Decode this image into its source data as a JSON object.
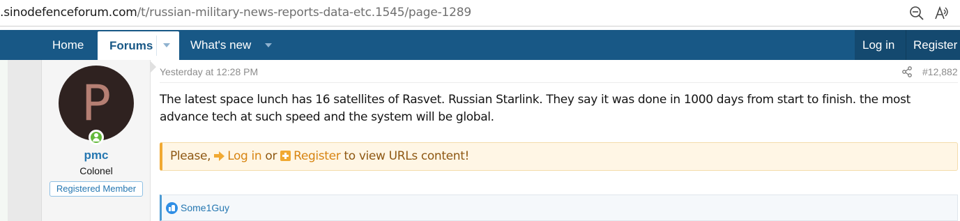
{
  "browser": {
    "url_host": ".sinodefenceforum.com",
    "url_path": "/t/russian-military-news-reports-data-etc.1545/page-1289",
    "icons": [
      "zoom-out-icon",
      "read-aloud-icon"
    ]
  },
  "nav": {
    "home": "Home",
    "forums": "Forums",
    "whats_new": "What's new",
    "login": "Log in",
    "register": "Register"
  },
  "post": {
    "user": {
      "avatar_letter": "P",
      "name": "pmc",
      "title": "Colonel",
      "banner": "Registered Member"
    },
    "date": "Yesterday at 12:28 PM",
    "number": "#12,882",
    "text": "The latest space lunch has 16 satellites of Rasvet. Russian Starlink. They say it was done in 1000 days from start to finish. the most advance tech at such speed and the system will be global.",
    "notice": {
      "prefix": "Please, ",
      "login": "Log in",
      "or": " or ",
      "register": "Register",
      "suffix": " to view URLs content!"
    },
    "reaction_user": "Some1Guy"
  },
  "colors": {
    "nav_bg": "#185886",
    "link": "#2577b1",
    "notice_accent": "#f1a932"
  }
}
